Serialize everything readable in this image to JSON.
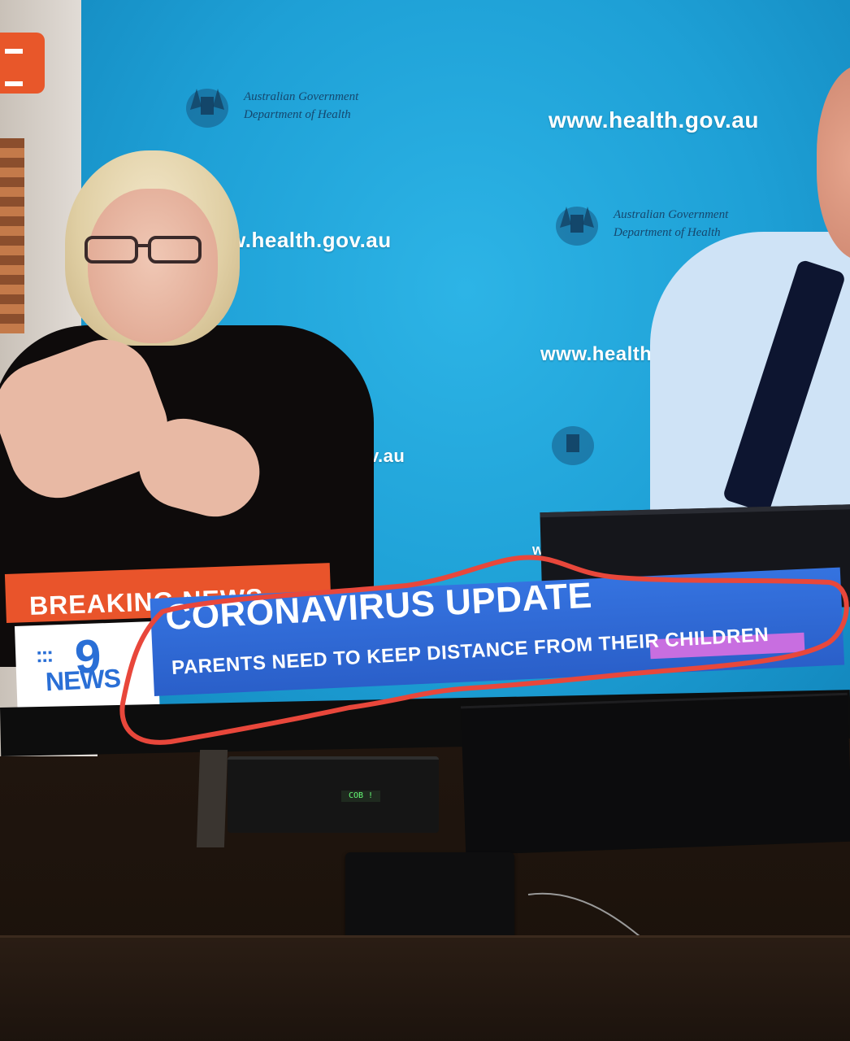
{
  "backdrop": {
    "website": "www.health.gov.au",
    "website_partial_1": "w.health.gov.au",
    "website_partial_2": "www.health.go",
    "website_partial_3": "ov.au",
    "website_partial_4": "ww",
    "gov_line_1": "Australian Government",
    "gov_line_2": "Department of Health"
  },
  "ticker": {
    "breaking_label": "BREAKING NEWS",
    "logo_number": "9",
    "logo_dots": ":::",
    "logo_word": "NEWS",
    "headline": "CORONAVIRUS UPDATE",
    "subline": "PARENTS NEED TO KEEP DISTANCE FROM THEIR CHILDREN"
  },
  "device": {
    "display_text": "COB !"
  },
  "colors": {
    "backdrop_blue": "#1ea0d6",
    "ticker_blue": "#2a5fc9",
    "breaking_orange": "#e9542b",
    "outline_red": "#e8473b",
    "accent_pink": "#c86ee0"
  }
}
